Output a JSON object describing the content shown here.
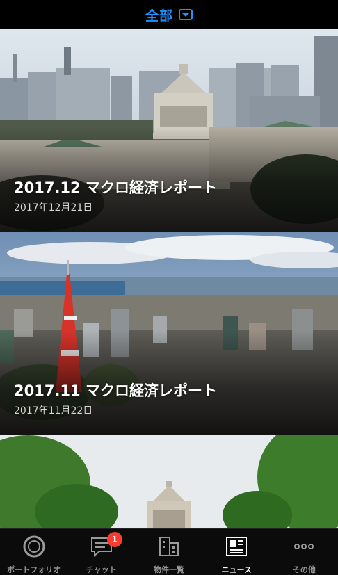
{
  "header": {
    "title": "全部",
    "dropdown_icon": "chevron-down-box-icon"
  },
  "articles": [
    {
      "title": "2017.12 マクロ経済レポート",
      "date": "2017年12月21日"
    },
    {
      "title": "2017.11 マクロ経済レポート",
      "date": "2017年11月22日"
    },
    {
      "title": "",
      "date": ""
    }
  ],
  "tabbar": {
    "tabs": [
      {
        "label": "ポートフォリオ",
        "icon": "portfolio-ring-icon",
        "active": false
      },
      {
        "label": "チャット",
        "icon": "chat-bubble-icon",
        "active": false,
        "badge": "1"
      },
      {
        "label": "物件一覧",
        "icon": "buildings-icon",
        "active": false
      },
      {
        "label": "ニュース",
        "icon": "newspaper-icon",
        "active": true
      },
      {
        "label": "その他",
        "icon": "more-dots-icon",
        "active": false
      }
    ]
  },
  "colors": {
    "accent": "#1e90ff",
    "badge": "#ff3b30",
    "background": "#000000"
  }
}
